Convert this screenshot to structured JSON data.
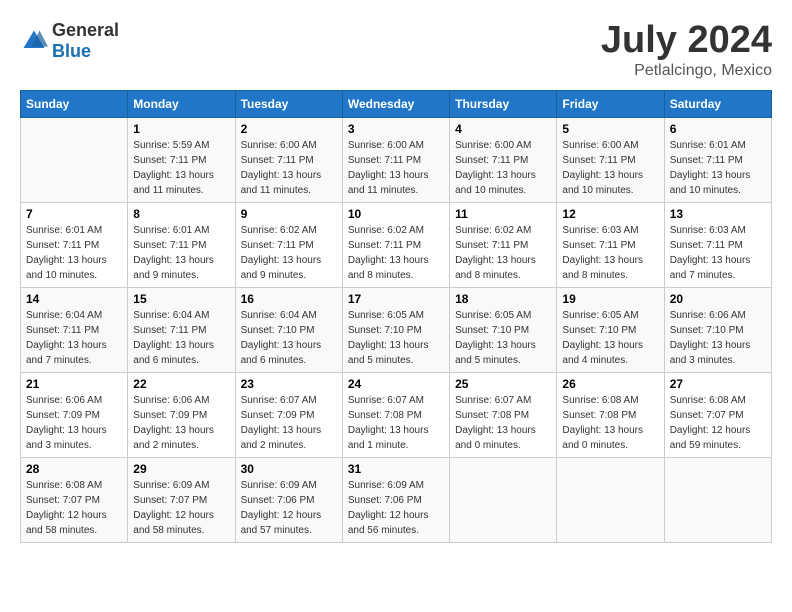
{
  "logo": {
    "general": "General",
    "blue": "Blue"
  },
  "title": "July 2024",
  "location": "Petlalcingo, Mexico",
  "days_header": [
    "Sunday",
    "Monday",
    "Tuesday",
    "Wednesday",
    "Thursday",
    "Friday",
    "Saturday"
  ],
  "weeks": [
    [
      {
        "day": "",
        "info": ""
      },
      {
        "day": "1",
        "info": "Sunrise: 5:59 AM\nSunset: 7:11 PM\nDaylight: 13 hours\nand 11 minutes."
      },
      {
        "day": "2",
        "info": "Sunrise: 6:00 AM\nSunset: 7:11 PM\nDaylight: 13 hours\nand 11 minutes."
      },
      {
        "day": "3",
        "info": "Sunrise: 6:00 AM\nSunset: 7:11 PM\nDaylight: 13 hours\nand 11 minutes."
      },
      {
        "day": "4",
        "info": "Sunrise: 6:00 AM\nSunset: 7:11 PM\nDaylight: 13 hours\nand 10 minutes."
      },
      {
        "day": "5",
        "info": "Sunrise: 6:00 AM\nSunset: 7:11 PM\nDaylight: 13 hours\nand 10 minutes."
      },
      {
        "day": "6",
        "info": "Sunrise: 6:01 AM\nSunset: 7:11 PM\nDaylight: 13 hours\nand 10 minutes."
      }
    ],
    [
      {
        "day": "7",
        "info": "Sunrise: 6:01 AM\nSunset: 7:11 PM\nDaylight: 13 hours\nand 10 minutes."
      },
      {
        "day": "8",
        "info": "Sunrise: 6:01 AM\nSunset: 7:11 PM\nDaylight: 13 hours\nand 9 minutes."
      },
      {
        "day": "9",
        "info": "Sunrise: 6:02 AM\nSunset: 7:11 PM\nDaylight: 13 hours\nand 9 minutes."
      },
      {
        "day": "10",
        "info": "Sunrise: 6:02 AM\nSunset: 7:11 PM\nDaylight: 13 hours\nand 8 minutes."
      },
      {
        "day": "11",
        "info": "Sunrise: 6:02 AM\nSunset: 7:11 PM\nDaylight: 13 hours\nand 8 minutes."
      },
      {
        "day": "12",
        "info": "Sunrise: 6:03 AM\nSunset: 7:11 PM\nDaylight: 13 hours\nand 8 minutes."
      },
      {
        "day": "13",
        "info": "Sunrise: 6:03 AM\nSunset: 7:11 PM\nDaylight: 13 hours\nand 7 minutes."
      }
    ],
    [
      {
        "day": "14",
        "info": "Sunrise: 6:04 AM\nSunset: 7:11 PM\nDaylight: 13 hours\nand 7 minutes."
      },
      {
        "day": "15",
        "info": "Sunrise: 6:04 AM\nSunset: 7:11 PM\nDaylight: 13 hours\nand 6 minutes."
      },
      {
        "day": "16",
        "info": "Sunrise: 6:04 AM\nSunset: 7:10 PM\nDaylight: 13 hours\nand 6 minutes."
      },
      {
        "day": "17",
        "info": "Sunrise: 6:05 AM\nSunset: 7:10 PM\nDaylight: 13 hours\nand 5 minutes."
      },
      {
        "day": "18",
        "info": "Sunrise: 6:05 AM\nSunset: 7:10 PM\nDaylight: 13 hours\nand 5 minutes."
      },
      {
        "day": "19",
        "info": "Sunrise: 6:05 AM\nSunset: 7:10 PM\nDaylight: 13 hours\nand 4 minutes."
      },
      {
        "day": "20",
        "info": "Sunrise: 6:06 AM\nSunset: 7:10 PM\nDaylight: 13 hours\nand 3 minutes."
      }
    ],
    [
      {
        "day": "21",
        "info": "Sunrise: 6:06 AM\nSunset: 7:09 PM\nDaylight: 13 hours\nand 3 minutes."
      },
      {
        "day": "22",
        "info": "Sunrise: 6:06 AM\nSunset: 7:09 PM\nDaylight: 13 hours\nand 2 minutes."
      },
      {
        "day": "23",
        "info": "Sunrise: 6:07 AM\nSunset: 7:09 PM\nDaylight: 13 hours\nand 2 minutes."
      },
      {
        "day": "24",
        "info": "Sunrise: 6:07 AM\nSunset: 7:08 PM\nDaylight: 13 hours\nand 1 minute."
      },
      {
        "day": "25",
        "info": "Sunrise: 6:07 AM\nSunset: 7:08 PM\nDaylight: 13 hours\nand 0 minutes."
      },
      {
        "day": "26",
        "info": "Sunrise: 6:08 AM\nSunset: 7:08 PM\nDaylight: 13 hours\nand 0 minutes."
      },
      {
        "day": "27",
        "info": "Sunrise: 6:08 AM\nSunset: 7:07 PM\nDaylight: 12 hours\nand 59 minutes."
      }
    ],
    [
      {
        "day": "28",
        "info": "Sunrise: 6:08 AM\nSunset: 7:07 PM\nDaylight: 12 hours\nand 58 minutes."
      },
      {
        "day": "29",
        "info": "Sunrise: 6:09 AM\nSunset: 7:07 PM\nDaylight: 12 hours\nand 58 minutes."
      },
      {
        "day": "30",
        "info": "Sunrise: 6:09 AM\nSunset: 7:06 PM\nDaylight: 12 hours\nand 57 minutes."
      },
      {
        "day": "31",
        "info": "Sunrise: 6:09 AM\nSunset: 7:06 PM\nDaylight: 12 hours\nand 56 minutes."
      },
      {
        "day": "",
        "info": ""
      },
      {
        "day": "",
        "info": ""
      },
      {
        "day": "",
        "info": ""
      }
    ]
  ]
}
